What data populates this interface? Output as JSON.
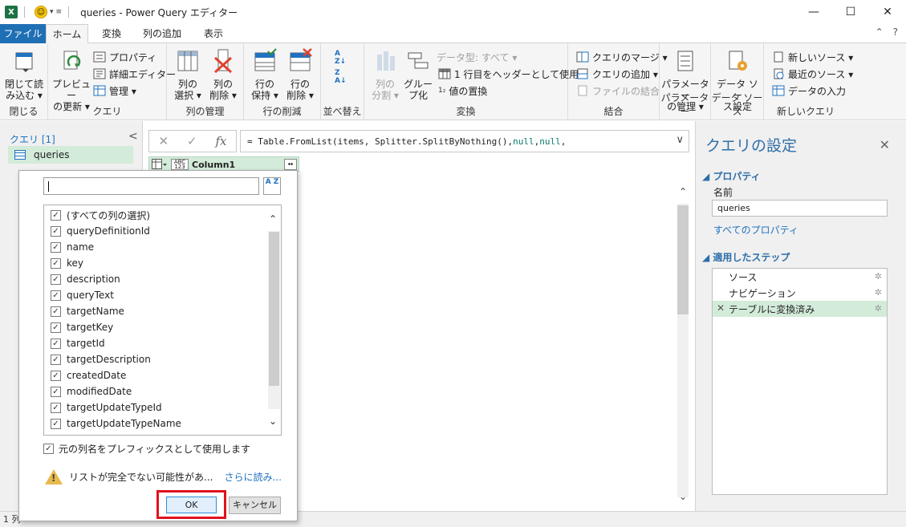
{
  "titlebar": {
    "title": "queries - Power Query エディター",
    "app_icon": "X",
    "minimize": "—",
    "maximize": "☐",
    "close": "✕"
  },
  "tabs": [
    {
      "label": "ファイル"
    },
    {
      "label": "ホーム"
    },
    {
      "label": "変換"
    },
    {
      "label": "列の追加"
    },
    {
      "label": "表示"
    }
  ],
  "help": {
    "collapse": "⌃",
    "help": "?"
  },
  "ribbon": {
    "close_group": {
      "label": "閉じる",
      "btn_line1": "閉じて読",
      "btn_line2": "み込む ▾"
    },
    "query_group": {
      "label": "クエリ",
      "preview_line1": "プレビュー",
      "preview_line2": "の更新 ▾",
      "properties": "プロパティ",
      "advanced_editor": "詳細エディター",
      "manage": "管理 ▾"
    },
    "col_manage_group": {
      "label": "列の管理",
      "select_line1": "列の",
      "select_line2": "選択 ▾",
      "remove_line1": "列の",
      "remove_line2": "削除 ▾"
    },
    "row_reduce_group": {
      "label": "行の削減",
      "keep_line1": "行の",
      "keep_line2": "保持 ▾",
      "remove_line1": "行の",
      "remove_line2": "削除 ▾"
    },
    "sort_group": {
      "label": "並べ替え"
    },
    "transform_group": {
      "label": "変換",
      "split_line1": "列の",
      "split_line2": "分割 ▾",
      "group_line1": "グルー",
      "group_line2": "プ化",
      "datatype": "データ型: すべて ▾",
      "first_row_header": "1 行目をヘッダーとして使用 ▾",
      "replace_values": "値の置換"
    },
    "combine_group": {
      "label": "結合",
      "merge": "クエリのマージ ▾",
      "append": "クエリの追加 ▾",
      "combine_files": "ファイルの結合"
    },
    "params_group": {
      "label": "パラメーター",
      "manage_line1": "パラメーター",
      "manage_line2": "の管理 ▾"
    },
    "datasource_group": {
      "label": "データ ソース",
      "settings_line1": "データ ソー",
      "settings_line2": "ス設定"
    },
    "newquery_group": {
      "label": "新しいクエリ",
      "new_source": "新しいソース ▾",
      "recent_source": "最近のソース ▾",
      "enter_data": "データの入力"
    }
  },
  "left_pane": {
    "header": "クエリ [1]",
    "collapse": "<",
    "items": [
      {
        "label": "queries"
      }
    ]
  },
  "formula": {
    "cancel": "✕",
    "commit": "✓",
    "fx": "fx",
    "prefix": "= Table.FromList(items, Splitter.SplitByNothing(), ",
    "null1": "null",
    "comma": ", ",
    "null2": "null",
    "suffix": ",",
    "chevron": "∨"
  },
  "column_header": {
    "type_icon": "ABC 123",
    "name": "Column1",
    "expand_icon": "↔"
  },
  "expand_popup": {
    "search_placeholder": "",
    "sort_icon": "A Z",
    "items": [
      {
        "label": "(すべての列の選択)",
        "checked": "✓"
      },
      {
        "label": "queryDefinitionId",
        "checked": "✓"
      },
      {
        "label": "name",
        "checked": "✓"
      },
      {
        "label": "key",
        "checked": "✓"
      },
      {
        "label": "description",
        "checked": "✓"
      },
      {
        "label": "queryText",
        "checked": "✓"
      },
      {
        "label": "targetName",
        "checked": "✓"
      },
      {
        "label": "targetKey",
        "checked": "✓"
      },
      {
        "label": "targetId",
        "checked": "✓"
      },
      {
        "label": "targetDescription",
        "checked": "✓"
      },
      {
        "label": "createdDate",
        "checked": "✓"
      },
      {
        "label": "modifiedDate",
        "checked": "✓"
      },
      {
        "label": "targetUpdateTypeId",
        "checked": "✓"
      },
      {
        "label": "targetUpdateTypeName",
        "checked": "✓"
      }
    ],
    "prefix_checkbox": "✓",
    "prefix_label": "元の列名をプレフィックスとして使用します",
    "warning_text": "リストが完全でない可能性があ...",
    "load_more": "さらに読み...",
    "ok": "OK",
    "cancel": "キャンセル"
  },
  "settings": {
    "title": "クエリの設定",
    "close": "✕",
    "properties_header": "◢ プロパティ",
    "name_label": "名前",
    "name_value": "queries",
    "all_properties": "すべてのプロパティ",
    "steps_header": "◢ 適用したステップ",
    "steps": [
      {
        "label": "ソース"
      },
      {
        "label": "ナビゲーション"
      },
      {
        "label": "テーブルに変換済み"
      }
    ]
  },
  "statusbar": {
    "text": "1 列"
  },
  "colors": {
    "accent": "#1f6fb5",
    "selection": "#d3ebd9",
    "highlight_box": "#e0121c"
  }
}
